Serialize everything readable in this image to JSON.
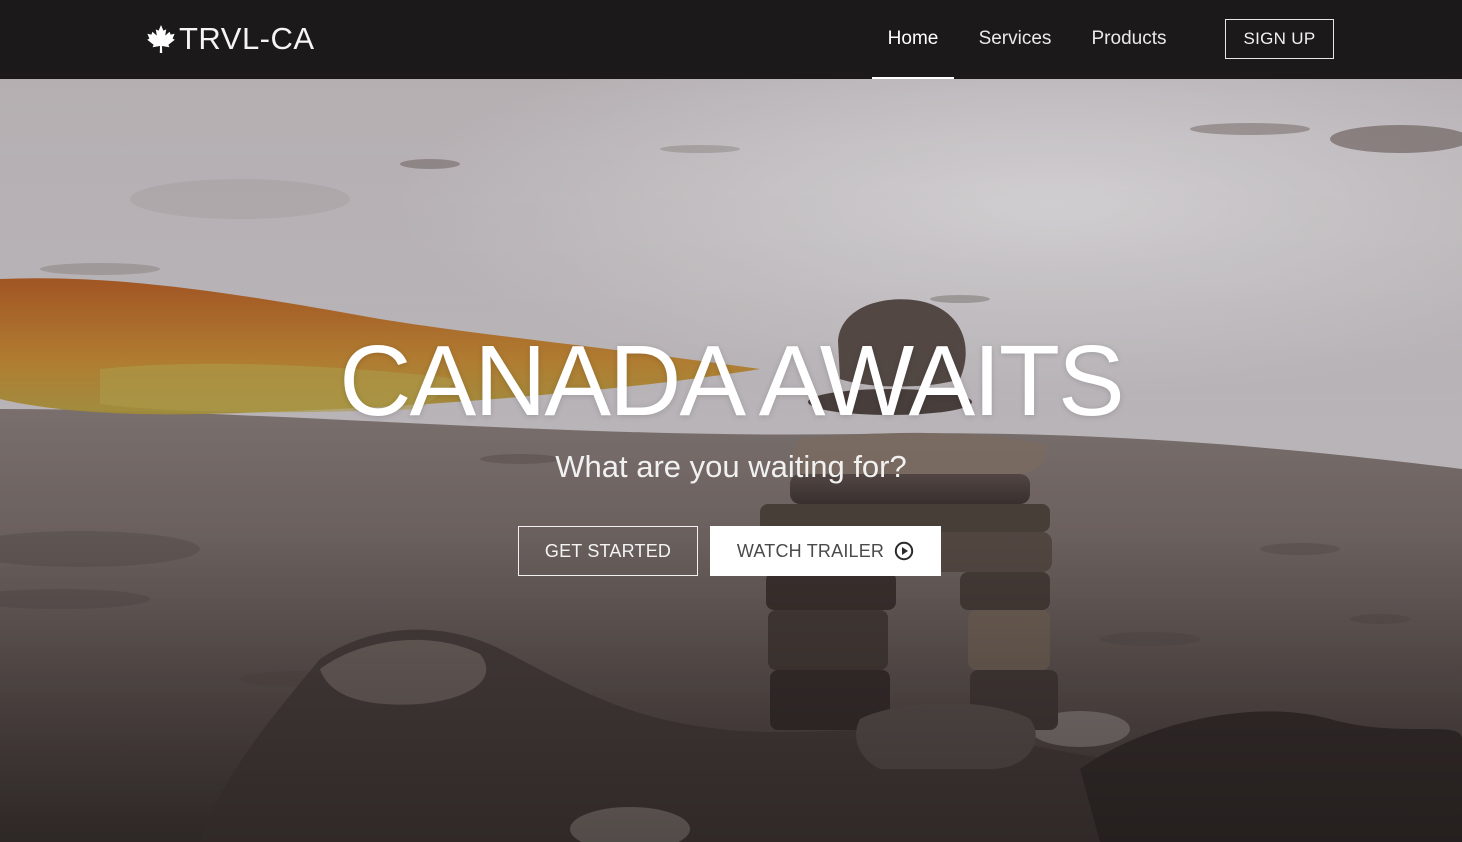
{
  "brand": {
    "name": "TRVL-CA",
    "icon": "maple-leaf-icon"
  },
  "nav": {
    "items": [
      {
        "label": "Home",
        "active": true
      },
      {
        "label": "Services",
        "active": false
      },
      {
        "label": "Products",
        "active": false
      }
    ],
    "signup_label": "SIGN UP"
  },
  "hero": {
    "title": "CANADA AWAITS",
    "subtitle": "What are you waiting for?",
    "primary_button": "GET STARTED",
    "secondary_button": "WATCH TRAILER",
    "secondary_icon": "play-circle-icon"
  },
  "colors": {
    "navbar_bg": "#1b1919",
    "text": "#ffffff",
    "button_fill": "#ffffff"
  }
}
